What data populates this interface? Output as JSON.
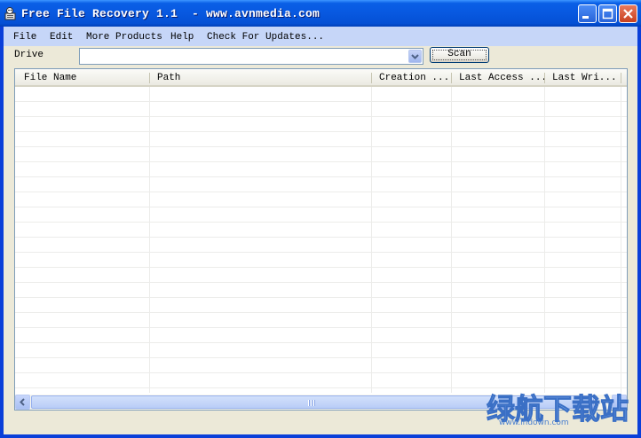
{
  "window": {
    "title": "Free File Recovery 1.1  - www.avnmedia.com",
    "controls": [
      "minimize-icon",
      "maximize-icon",
      "close-icon"
    ]
  },
  "menu": {
    "items": [
      "File",
      "Edit",
      "More Products",
      "Help",
      "Check For Updates..."
    ]
  },
  "toolbar": {
    "drive_label": "Drive",
    "drive_value": "",
    "scan_label": "Scan"
  },
  "list": {
    "columns": [
      "File Name",
      "Path",
      "Creation ...",
      "Last Access ...",
      "Last Wri..."
    ],
    "rows": []
  },
  "scrollbar": {
    "left_icon": "chevron-left-icon",
    "right_icon": "chevron-right-icon"
  },
  "watermark": {
    "text": "绿航下载站",
    "url": "www.lhdown.com"
  },
  "colors": {
    "titlebar": "#0858e0",
    "menubar": "#c6d6f8",
    "client": "#ece9d8",
    "list_border": "#7f9db9"
  }
}
